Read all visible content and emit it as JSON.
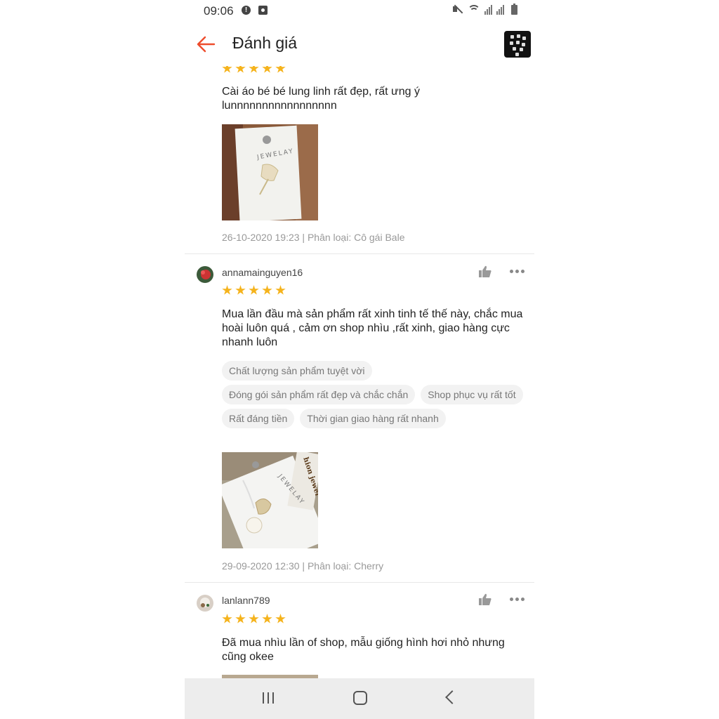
{
  "status_bar": {
    "time": "09:06",
    "alert_icon": "alert-circle-icon",
    "app_icon": "app-notification-icon",
    "right_icons": [
      "mute-icon",
      "wifi-icon",
      "signal-icon",
      "signal-icon",
      "battery-icon"
    ]
  },
  "header": {
    "title": "Đánh giá",
    "back_icon": "arrow-left-icon",
    "accent_color": "#ee4d2d"
  },
  "reviews": [
    {
      "stars": 5,
      "comment": "Cài áo bé bé lung linh rất đẹp, rất ưng ý lunnnnnnnnnnnnnnnnn",
      "meta": "26-10-2020 19:23 | Phân loại: Cô gái Bale"
    },
    {
      "username": "annamainguyen16",
      "stars": 5,
      "comment": "Mua lần đầu mà sản phẩm rất xinh tinh tế thế này, chắc mua hoài luôn quá , cảm ơn shop nhìu ,rất xinh, giao hàng cực nhanh luôn",
      "tags": [
        "Chất lượng sản phẩm tuyệt vời",
        "Đóng gói sản phẩm rất đẹp và chắc chắn",
        "Shop phục vụ rất tốt",
        "Rất đáng tiền",
        "Thời gian giao hàng rất nhanh"
      ],
      "meta": "29-09-2020 12:30 | Phân loại: Cherry"
    },
    {
      "username": "lanlann789",
      "stars": 5,
      "comment": "Đã mua nhìu lần of shop, mẫu giống hình hơi nhỏ nhưng cũng okee"
    }
  ],
  "photo_card_text": "JEWELAY",
  "photo_card_text_2": "hion jewel",
  "star_color": "#f5b31c",
  "nav_bar": {
    "icons": [
      "recent-apps-icon",
      "home-icon",
      "back-icon"
    ]
  }
}
